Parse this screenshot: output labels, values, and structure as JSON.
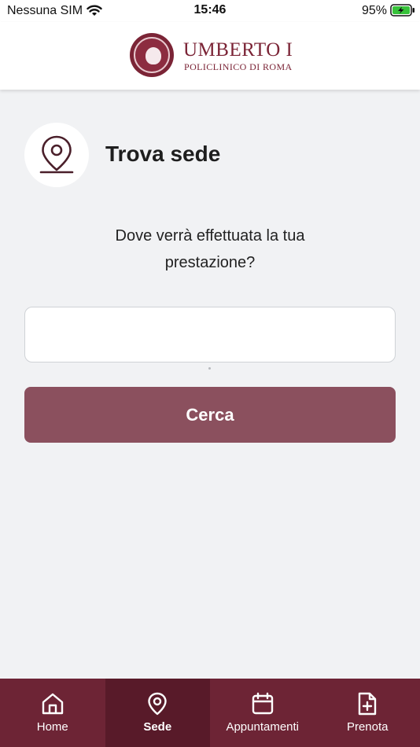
{
  "status_bar": {
    "carrier": "Nessuna SIM",
    "time": "15:46",
    "battery": "95%"
  },
  "header": {
    "logo_title": "UMBERTO I",
    "logo_subtitle": "POLICLINICO DI ROMA"
  },
  "page": {
    "title": "Trova sede",
    "title_icon": "map-pin-icon",
    "question": "Dove verrà effettuata la tua prestazione?"
  },
  "search": {
    "value": "",
    "placeholder": "",
    "button_label": "Cerca"
  },
  "tabbar": {
    "items": [
      {
        "label": "Home",
        "icon": "home-icon",
        "active": false
      },
      {
        "label": "Sede",
        "icon": "map-pin-icon",
        "active": true
      },
      {
        "label": "Appuntamenti",
        "icon": "calendar-icon",
        "active": false
      },
      {
        "label": "Prenota",
        "icon": "file-plus-icon",
        "active": false
      }
    ]
  },
  "colors": {
    "brand": "#7b2436",
    "tabbar_background": "#6d2435",
    "tabbar_active": "#581a29",
    "button": "#8b505e",
    "page_background": "#f1f2f4"
  }
}
